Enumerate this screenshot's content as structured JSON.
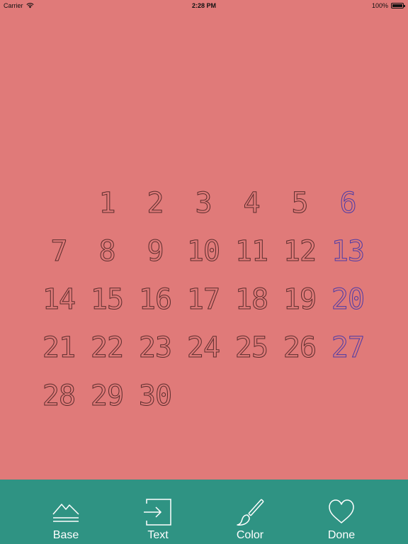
{
  "status_bar": {
    "carrier": "Carrier",
    "time": "2:28 PM",
    "battery": "100%",
    "battery_level": 1.0
  },
  "calendar": {
    "background_color": "#e07a79",
    "weekday_stroke_color": "#5a2c2c",
    "weekend_stroke_color": "#4a3aa8",
    "weeks": [
      [
        "",
        "1",
        "2",
        "3",
        "4",
        "5",
        "6"
      ],
      [
        "7",
        "8",
        "9",
        "10",
        "11",
        "12",
        "13"
      ],
      [
        "14",
        "15",
        "16",
        "17",
        "18",
        "19",
        "20"
      ],
      [
        "21",
        "22",
        "23",
        "24",
        "25",
        "26",
        "27"
      ],
      [
        "28",
        "29",
        "30",
        "",
        "",
        "",
        ""
      ]
    ]
  },
  "toolbar": {
    "background_color": "#2f9383",
    "items": [
      {
        "label": "Base",
        "icon": "mountains-icon"
      },
      {
        "label": "Text",
        "icon": "sign-in-icon"
      },
      {
        "label": "Color",
        "icon": "paintbrush-icon"
      },
      {
        "label": "Done",
        "icon": "heart-icon"
      }
    ]
  }
}
